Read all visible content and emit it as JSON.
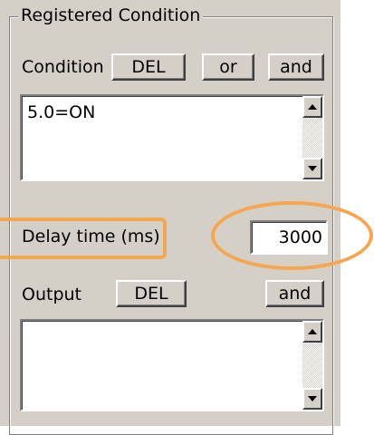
{
  "group": {
    "title": "Registered Condition"
  },
  "condition": {
    "label": "Condition",
    "del_label": "DEL",
    "or_label": "or",
    "and_label": "and",
    "items": [
      "5.0=ON"
    ]
  },
  "delay": {
    "label": "Delay time (ms)",
    "value": "3000"
  },
  "output": {
    "label": "Output",
    "del_label": "DEL",
    "and_label": "and",
    "items": []
  },
  "colors": {
    "panel": "#d4d0c8",
    "highlight_annotation": "#f7a650"
  }
}
